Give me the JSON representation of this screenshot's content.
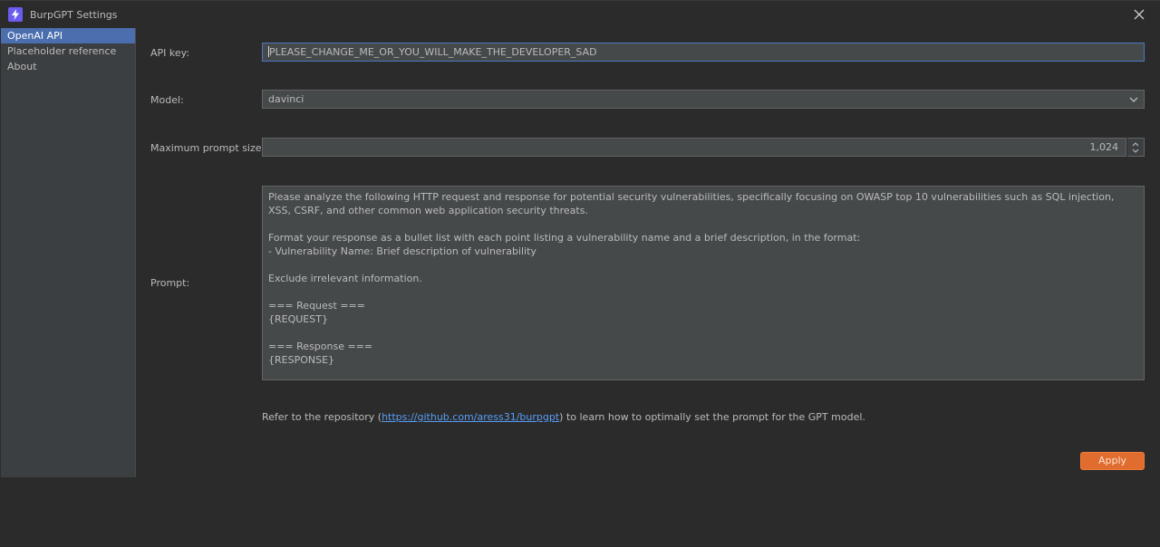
{
  "window": {
    "title": "BurpGPT Settings",
    "accent_color": "#4b6eaf",
    "apply_color": "#e06c2e",
    "link_color": "#589df6"
  },
  "sidebar": {
    "items": [
      {
        "label": "OpenAI API",
        "selected": true
      },
      {
        "label": "Placeholder reference",
        "selected": false
      },
      {
        "label": "About",
        "selected": false
      }
    ]
  },
  "form": {
    "api_key_label": "API key:",
    "api_key_value": "PLEASE_CHANGE_ME_OR_YOU_WILL_MAKE_THE_DEVELOPER_SAD",
    "model_label": "Model:",
    "model_value": "davinci",
    "max_prompt_label": "Maximum prompt size:",
    "max_prompt_value": "1,024",
    "prompt_label": "Prompt:",
    "prompt_value": "Please analyze the following HTTP request and response for potential security vulnerabilities, specifically focusing on OWASP top 10 vulnerabilities such as SQL injection, XSS, CSRF, and other common web application security threats.\n\nFormat your response as a bullet list with each point listing a vulnerability name and a brief description, in the format:\n- Vulnerability Name: Brief description of vulnerability\n\nExclude irrelevant information.\n\n=== Request ===\n{REQUEST}\n\n=== Response ===\n{RESPONSE}"
  },
  "footer": {
    "text_before": "Refer to the repository (",
    "link_text": "https://github.com/aress31/burpgpt",
    "text_after": ") to learn how to optimally set the prompt for the GPT model."
  },
  "actions": {
    "apply_label": "Apply"
  },
  "icons": {
    "app": "lightning-icon",
    "close": "close-icon",
    "dropdown": "chevron-down-icon",
    "spinner": "spinner-arrows-icon"
  }
}
